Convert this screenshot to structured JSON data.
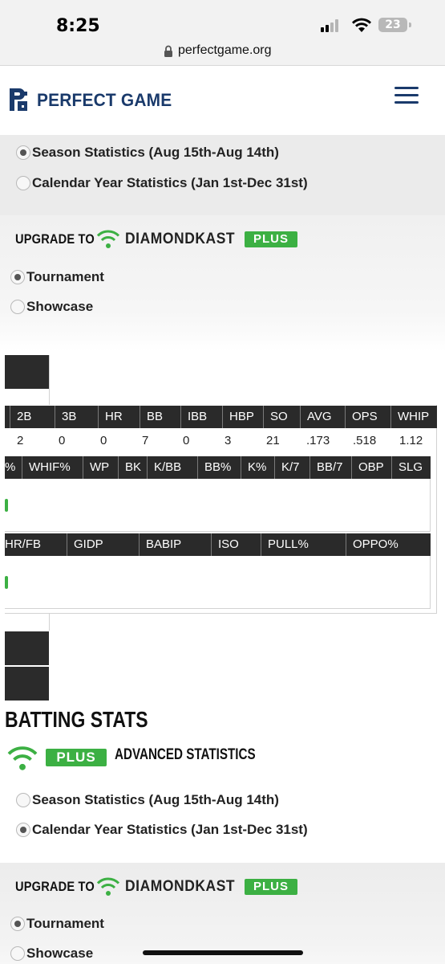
{
  "status_bar": {
    "time": "8:25",
    "battery": "23"
  },
  "browser": {
    "url": "perfectgame.org"
  },
  "header": {
    "logo_text": "PERFECT GAME"
  },
  "season_options": [
    {
      "label": "Season Statistics (Aug 15th-Aug 14th)",
      "checked": true
    },
    {
      "label": "Calendar Year Statistics (Jan 1st-Dec 31st)",
      "checked": false
    }
  ],
  "upgrade": {
    "label": "UPGRADE TO",
    "brand": "DIAMONDKAST",
    "plus": "PLUS"
  },
  "event_options": [
    {
      "label": "Tournament",
      "checked": true
    },
    {
      "label": "Showcase",
      "checked": false
    }
  ],
  "table1": {
    "headers": [
      "2B",
      "3B",
      "HR",
      "BB",
      "IBB",
      "HBP",
      "SO",
      "AVG",
      "OPS",
      "WHIP"
    ],
    "values": [
      "2",
      "0",
      "0",
      "7",
      "0",
      "3",
      "21",
      ".173",
      ".518",
      "1.12"
    ]
  },
  "table2": {
    "headers": [
      "%",
      "WHIF%",
      "WP",
      "BK",
      "K/BB",
      "BB%",
      "K%",
      "K/7",
      "BB/7",
      "OBP",
      "SLG"
    ]
  },
  "table3": {
    "headers": [
      "HR/FB",
      "GIDP",
      "BABIP",
      "ISO",
      "PULL%",
      "OPPO%"
    ]
  },
  "batting": {
    "title": "BATTING STATS",
    "plus": "PLUS",
    "advanced_label": "ADVANCED STATISTICS",
    "season_options": [
      {
        "label": "Season Statistics (Aug 15th-Aug 14th)",
        "checked": false
      },
      {
        "label": "Calendar Year Statistics (Jan 1st-Dec 31st)",
        "checked": true
      }
    ],
    "upgrade": {
      "label": "UPGRADE TO",
      "brand": "DIAMONDKAST",
      "plus": "PLUS"
    },
    "event_options": [
      {
        "label": "Tournament",
        "checked": true
      },
      {
        "label": "Showcase",
        "checked": false
      }
    ]
  },
  "colors": {
    "brand_navy": "#1a3a6b",
    "plus_green": "#3cb043",
    "table_header": "#2a2a2a"
  }
}
